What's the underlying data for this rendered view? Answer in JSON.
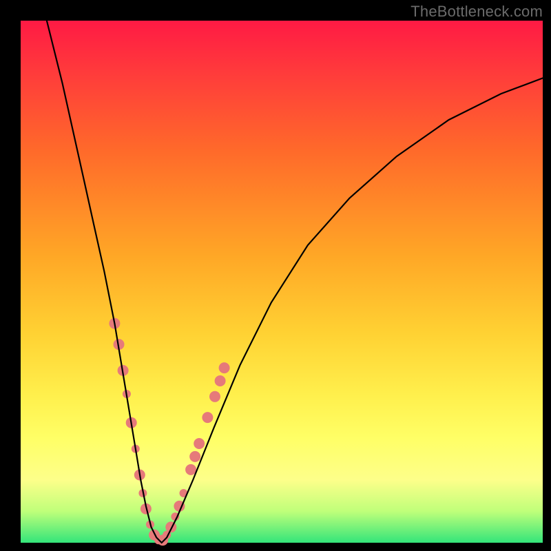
{
  "watermark": "TheBottleneck.com",
  "chart_data": {
    "type": "line",
    "title": "",
    "xlabel": "",
    "ylabel": "",
    "xlim": [
      0,
      100
    ],
    "ylim": [
      0,
      100
    ],
    "series": [
      {
        "name": "bottleneck-curve",
        "x": [
          5,
          8,
          10,
          12,
          14,
          16,
          18,
          19,
          20,
          21,
          22,
          23,
          24,
          25,
          26,
          27,
          28,
          30,
          33,
          37,
          42,
          48,
          55,
          63,
          72,
          82,
          92,
          100
        ],
        "y": [
          100,
          88,
          79,
          70,
          61,
          52,
          42,
          36,
          30,
          24,
          18,
          12,
          7,
          3,
          1,
          0,
          1,
          5,
          12,
          22,
          34,
          46,
          57,
          66,
          74,
          81,
          86,
          89
        ]
      }
    ],
    "markers": {
      "name": "highlight-dots",
      "color": "#e67a7a",
      "points": [
        {
          "x": 18.0,
          "y": 42.0,
          "r": 8
        },
        {
          "x": 18.8,
          "y": 38.0,
          "r": 8
        },
        {
          "x": 19.6,
          "y": 33.0,
          "r": 8
        },
        {
          "x": 20.3,
          "y": 28.5,
          "r": 6
        },
        {
          "x": 21.2,
          "y": 23.0,
          "r": 8
        },
        {
          "x": 22.0,
          "y": 18.0,
          "r": 6
        },
        {
          "x": 22.8,
          "y": 13.0,
          "r": 8
        },
        {
          "x": 23.4,
          "y": 9.5,
          "r": 6
        },
        {
          "x": 24.0,
          "y": 6.5,
          "r": 8
        },
        {
          "x": 24.8,
          "y": 3.5,
          "r": 6
        },
        {
          "x": 25.6,
          "y": 1.5,
          "r": 8
        },
        {
          "x": 26.4,
          "y": 0.5,
          "r": 6
        },
        {
          "x": 27.2,
          "y": 0.5,
          "r": 8
        },
        {
          "x": 28.0,
          "y": 1.5,
          "r": 6
        },
        {
          "x": 28.8,
          "y": 3.0,
          "r": 8
        },
        {
          "x": 29.6,
          "y": 5.0,
          "r": 6
        },
        {
          "x": 30.4,
          "y": 7.0,
          "r": 8
        },
        {
          "x": 31.2,
          "y": 9.5,
          "r": 6
        },
        {
          "x": 32.6,
          "y": 14.0,
          "r": 8
        },
        {
          "x": 33.4,
          "y": 16.5,
          "r": 8
        },
        {
          "x": 34.2,
          "y": 19.0,
          "r": 8
        },
        {
          "x": 35.8,
          "y": 24.0,
          "r": 8
        },
        {
          "x": 37.2,
          "y": 28.0,
          "r": 8
        },
        {
          "x": 38.2,
          "y": 31.0,
          "r": 8
        },
        {
          "x": 39.0,
          "y": 33.5,
          "r": 8
        }
      ]
    }
  }
}
